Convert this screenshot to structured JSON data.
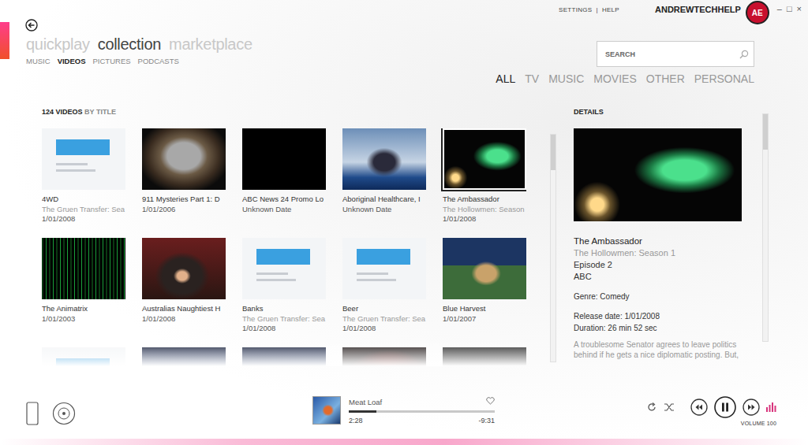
{
  "window": {
    "controls": [
      "–",
      "□",
      "×"
    ]
  },
  "header": {
    "links": [
      "SETTINGS",
      "|",
      "HELP"
    ],
    "user": "ANDREWTECHHELP",
    "avatar": "AE"
  },
  "nav": {
    "pivots": [
      {
        "label": "quickplay",
        "selected": false
      },
      {
        "label": "collection",
        "selected": true
      },
      {
        "label": "marketplace",
        "selected": false
      }
    ],
    "subnav": [
      {
        "label": "MUSIC",
        "selected": false
      },
      {
        "label": "VIDEOS",
        "selected": true
      },
      {
        "label": "PICTURES",
        "selected": false
      },
      {
        "label": "PODCASTS",
        "selected": false
      }
    ]
  },
  "search": {
    "placeholder": "SEARCH"
  },
  "filters": [
    {
      "label": "ALL",
      "selected": true
    },
    {
      "label": "TV",
      "selected": false
    },
    {
      "label": "MUSIC",
      "selected": false
    },
    {
      "label": "MOVIES",
      "selected": false
    },
    {
      "label": "OTHER",
      "selected": false
    },
    {
      "label": "PERSONAL",
      "selected": false
    }
  ],
  "list": {
    "count": "124 VIDEOS",
    "sort": "BY TITLE",
    "scroll_position": 0,
    "items": [
      {
        "title": "4WD",
        "subtitle": "The Gruen Transfer: Sea",
        "date": "1/01/2008",
        "kind": "card",
        "selected": false
      },
      {
        "title": "911 Mysteries Part 1: D",
        "date": "1/01/2006",
        "kind": "tv",
        "selected": false
      },
      {
        "title": "ABC News 24 Promo Lo",
        "date": "Unknown Date",
        "kind": "black",
        "selected": false
      },
      {
        "title": "Aboriginal Healthcare, I",
        "date": "Unknown Date",
        "kind": "news",
        "selected": false
      },
      {
        "title": "The Ambassador",
        "subtitle": "The Hollowmen: Season",
        "date": "1/01/2008",
        "kind": "night",
        "selected": true
      },
      {
        "title": "The Animatrix",
        "date": "1/01/2003",
        "kind": "matrix",
        "selected": false
      },
      {
        "title": "Australias Naughtiest H",
        "date": "1/01/2008",
        "kind": "presenter",
        "selected": false
      },
      {
        "title": "Banks",
        "subtitle": "The Gruen Transfer: Sea",
        "date": "1/01/2008",
        "kind": "card",
        "selected": false
      },
      {
        "title": "Beer",
        "subtitle": "The Gruen Transfer: Sea",
        "date": "1/01/2008",
        "kind": "card",
        "selected": false
      },
      {
        "title": "Blue Harvest",
        "date": "1/01/2007",
        "kind": "cartoon",
        "selected": false
      },
      {
        "kind": "card",
        "selected": false
      },
      {
        "kind": "storm",
        "selected": false
      },
      {
        "kind": "storm",
        "selected": false
      },
      {
        "kind": "red",
        "selected": false
      },
      {
        "kind": "dark",
        "selected": false
      }
    ]
  },
  "details": {
    "heading": "DETAILS",
    "preview_kind": "night",
    "title": "The Ambassador",
    "series": "The Hollowmen: Season 1",
    "episode": "Episode 2",
    "network": "ABC",
    "genre": "Genre: Comedy",
    "release": "Release date: 1/01/2008",
    "duration": "Duration: 26 min 52 sec",
    "description": "A troublesome Senator agrees to leave politics behind if he gets a nice diplomatic posting. But,",
    "scroll_position": 0
  },
  "player": {
    "artist": "Meat Loaf",
    "elapsed": "2:28",
    "remaining": "-9:31",
    "level": 0.19,
    "favorite": false,
    "playing": true,
    "volume_label": "VOLUME 100"
  }
}
